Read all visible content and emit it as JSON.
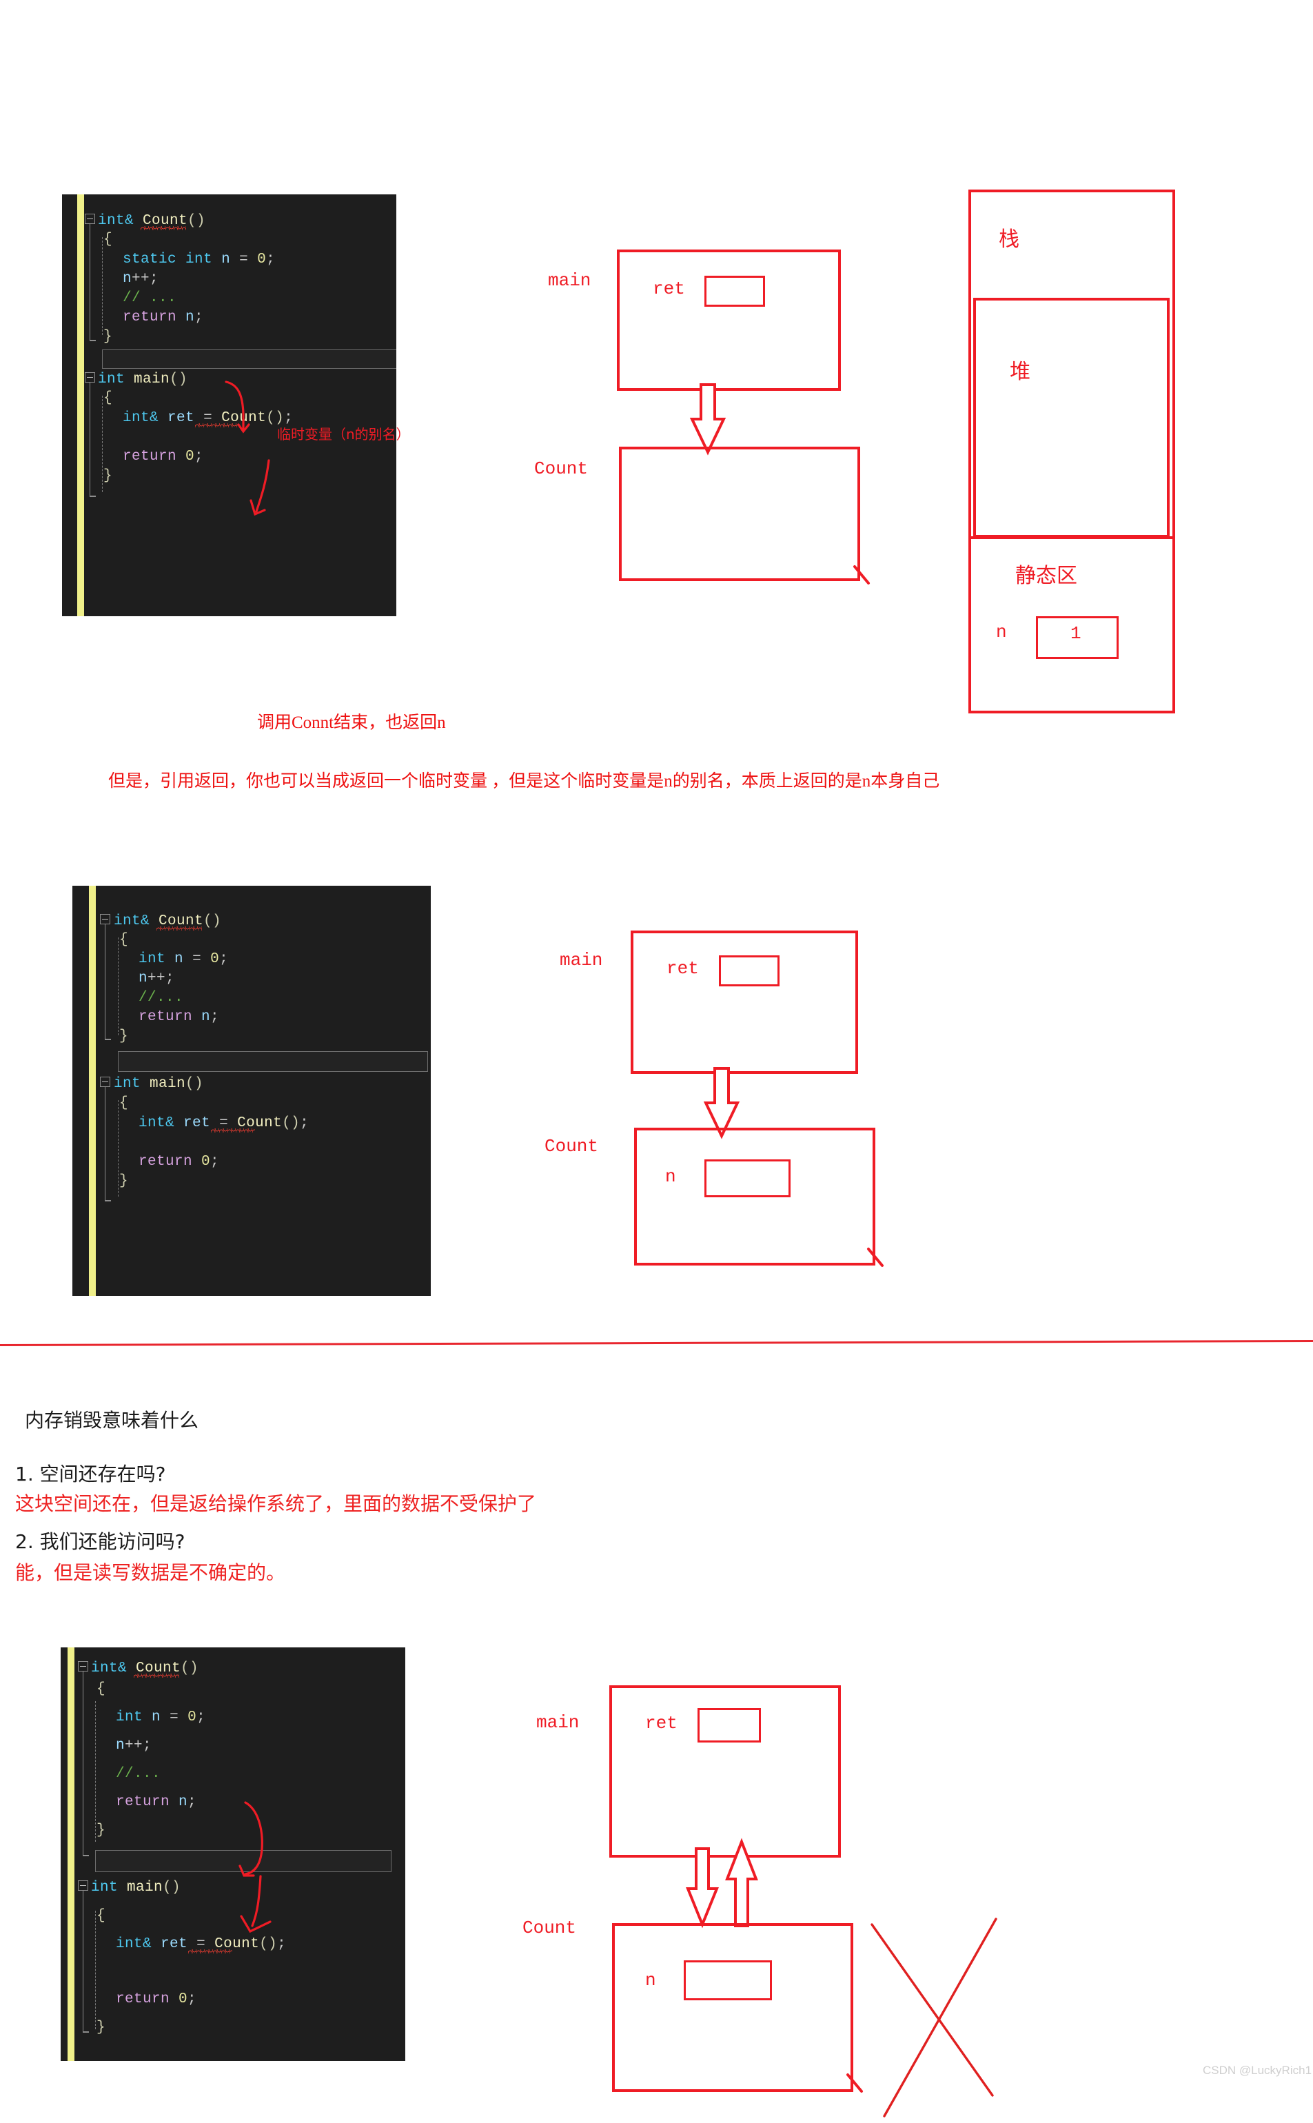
{
  "page": {
    "watermark": "CSDN @LuckyRich1"
  },
  "section1": {
    "code": {
      "lines": [
        "int& Count()",
        "{",
        "    static int n = 0;",
        "    n++;",
        "    // ...",
        "    return n;",
        "}",
        "int main()",
        "{",
        "    int& ret = Count();",
        "",
        "    return 0;",
        "}"
      ],
      "annotation": "临时变量（n的别名）"
    },
    "diagram": {
      "frame_main_label": "main",
      "frame_main_var": "ret",
      "frame_count_label": "Count"
    },
    "memory": {
      "stack_label": "栈",
      "heap_label": "堆",
      "static_label": "静态区",
      "static_var": "n",
      "static_value": "1"
    },
    "caption": "调用Connt结束，也返回n",
    "note": "但是，引用返回，你也可以当成返回一个临时变量 ，但是这个临时变量是n的别名，本质上返回的是n本身自己"
  },
  "section2": {
    "code": {
      "lines": [
        "int& Count()",
        "{",
        "    int n = 0;",
        "    n++;",
        "    //...",
        "    return n;",
        "}",
        "int main()",
        "{",
        "    int& ret = Count();",
        "",
        "    return 0;",
        "}"
      ]
    },
    "diagram": {
      "frame_main_label": "main",
      "frame_main_var": "ret",
      "frame_count_label": "Count",
      "frame_count_var": "n"
    }
  },
  "section3": {
    "heading": "内存销毁意味着什么",
    "q1": "1. 空间还存在吗?",
    "a1": "这块空间还在，但是返给操作系统了，里面的数据不受保护了",
    "q2": "2. 我们还能访问吗?",
    "a2": "能，但是读写数据是不确定的。"
  },
  "section4": {
    "code": {
      "lines": [
        "int& Count()",
        "{",
        "    int n = 0;",
        "    n++;",
        "    //...",
        "    return n;",
        "}",
        "int main()",
        "{",
        "    int& ret = Count();",
        "",
        "    return 0;",
        "}"
      ]
    },
    "diagram": {
      "frame_main_label": "main",
      "frame_main_var": "ret",
      "frame_count_label": "Count",
      "frame_count_var": "n"
    }
  },
  "colors": {
    "annotation_red": "#ef1c25",
    "code_bg": "#1e1e1e",
    "keyword_blue": "#4ec9f0",
    "function_yellow": "#f2efc0",
    "comment_green": "#6ab04c",
    "return_purple": "#d7a3e0",
    "gutter_yellow": "#f0f08a"
  }
}
